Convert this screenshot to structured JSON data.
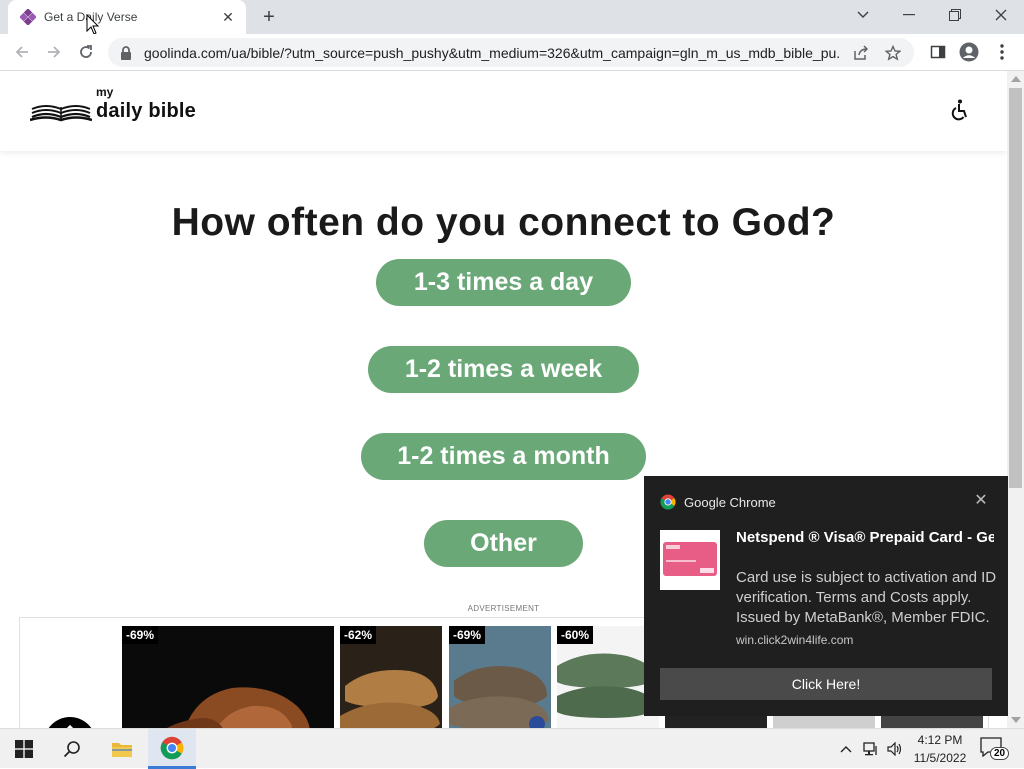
{
  "browser": {
    "tab_title": "Get a Daily Verse",
    "url": "goolinda.com/ua/bible/?utm_source=push_pushy&utm_medium=326&utm_campaign=gln_m_us_mdb_bible_pu..."
  },
  "site": {
    "logo_small": "my",
    "logo_main": "daily bible"
  },
  "quiz": {
    "question": "How often do you connect to God?",
    "options": [
      "1-3 times a day",
      "1-2 times a week",
      "1-2 times a month",
      "Other"
    ]
  },
  "ad": {
    "label": "ADVERTISEMENT",
    "products": [
      {
        "discount": "-69%"
      },
      {
        "discount": "-62%"
      },
      {
        "discount": "-69%"
      },
      {
        "discount": "-60%"
      }
    ]
  },
  "notification": {
    "app": "Google Chrome",
    "title": "Netspend ® Visa® Prepaid Card - Get paid faster than a paper check wit",
    "body": "Card use is subject to activation and ID verification. Terms and Costs apply. Issued by MetaBank®, Member FDIC.",
    "site": "win.click2win4life.com",
    "action": "Click Here!"
  },
  "taskbar": {
    "time": "4:12 PM",
    "date": "11/5/2022",
    "notification_count": "20"
  },
  "colors": {
    "option_button": "#6aa878",
    "notification_bg": "#1f1f1f"
  }
}
